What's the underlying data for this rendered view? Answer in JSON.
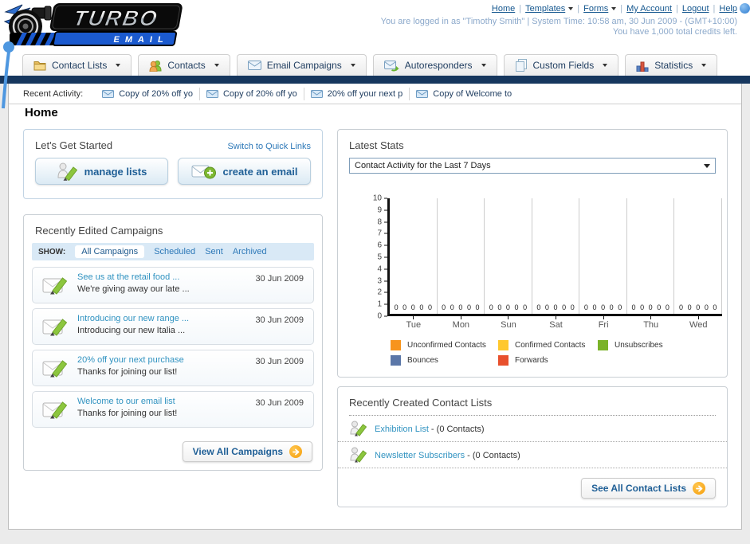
{
  "header": {
    "logo_title": "TURBO",
    "logo_subtitle": "EMAIL",
    "nav": {
      "home": "Home",
      "templates": "Templates",
      "forms": "Forms",
      "my_account": "My Account",
      "logout": "Logout",
      "help": "Help"
    },
    "login_line1": "You are logged in as \"Timothy Smith\" | System Time: 10:58 am, 30 Jun 2009 - (GMT+10:00)",
    "login_line2": "You have 1,000 total credits left."
  },
  "tabs": [
    {
      "label": "Contact Lists",
      "icon": "folder-icon"
    },
    {
      "label": "Contacts",
      "icon": "contacts-icon"
    },
    {
      "label": "Email Campaigns",
      "icon": "envelope-icon"
    },
    {
      "label": "Autoresponders",
      "icon": "autoresponder-icon"
    },
    {
      "label": "Custom Fields",
      "icon": "custom-fields-icon"
    },
    {
      "label": "Statistics",
      "icon": "statistics-icon"
    }
  ],
  "recent_activity": {
    "label": "Recent Activity:",
    "items": [
      {
        "text": "Copy of 20% off yo"
      },
      {
        "text": "Copy of 20% off yo"
      },
      {
        "text": "20% off your next p"
      },
      {
        "text": "Copy of Welcome to"
      }
    ]
  },
  "page_title": "Home",
  "get_started": {
    "title": "Let's Get Started",
    "switch_link": "Switch to Quick Links",
    "manage_lists_label": "manage lists",
    "create_email_label": "create an email"
  },
  "campaigns_panel": {
    "title": "Recently Edited Campaigns",
    "show_label": "SHOW:",
    "filters": [
      {
        "label": "All Campaigns",
        "active": true
      },
      {
        "label": "Scheduled",
        "active": false
      },
      {
        "label": "Sent",
        "active": false
      },
      {
        "label": "Archived",
        "active": false
      }
    ],
    "items": [
      {
        "title": "See us at the retail food ...",
        "subtitle": "We're giving away our late ...",
        "date": "30 Jun 2009"
      },
      {
        "title": "Introducing our new range ...",
        "subtitle": "Introducing our new Italia ...",
        "date": "30 Jun 2009"
      },
      {
        "title": "20% off your next purchase",
        "subtitle": "Thanks for joining our list!",
        "date": "30 Jun 2009"
      },
      {
        "title": "Welcome to our email list",
        "subtitle": "Thanks for joining our list!",
        "date": "30 Jun 2009"
      }
    ],
    "view_all_label": "View All Campaigns"
  },
  "stats_panel": {
    "title": "Latest Stats",
    "dropdown_value": "Contact Activity for the Last 7 Days"
  },
  "chart_data": {
    "type": "bar",
    "title": "Contact Activity for the Last 7 Days",
    "categories": [
      "Tue",
      "Mon",
      "Sun",
      "Sat",
      "Fri",
      "Thu",
      "Wed"
    ],
    "series": [
      {
        "name": "Unconfirmed Contacts",
        "color": "#F7941D",
        "values": [
          0,
          0,
          0,
          0,
          0,
          0,
          0
        ]
      },
      {
        "name": "Confirmed Contacts",
        "color": "#FFC82E",
        "values": [
          0,
          0,
          0,
          0,
          0,
          0,
          0
        ]
      },
      {
        "name": "Unsubscribes",
        "color": "#7AB329",
        "values": [
          0,
          0,
          0,
          0,
          0,
          0,
          0
        ]
      },
      {
        "name": "Bounces",
        "color": "#5B77A8",
        "values": [
          0,
          0,
          0,
          0,
          0,
          0,
          0
        ]
      },
      {
        "name": "Forwards",
        "color": "#E8502D",
        "values": [
          0,
          0,
          0,
          0,
          0,
          0,
          0
        ]
      }
    ],
    "ylim": [
      0,
      10
    ],
    "ytick_step": 1,
    "grid": "vertical-group-separators",
    "legend_position": "bottom",
    "value_labels_shown": true
  },
  "contact_lists_panel": {
    "title": "Recently Created Contact Lists",
    "items": [
      {
        "name": "Exhibition List",
        "detail": " - (0 Contacts)"
      },
      {
        "name": "Newsletter Subscribers",
        "detail": " - (0 Contacts)"
      }
    ],
    "see_all_label": "See All Contact Lists"
  },
  "colors": {
    "navy_bar": "#17375E",
    "link_blue": "#15578F",
    "teal_link": "#3193C1",
    "accent_orange": "#F5A31A",
    "page_background": "#EBEBEB",
    "filter_bar": "#D9E9F6"
  }
}
